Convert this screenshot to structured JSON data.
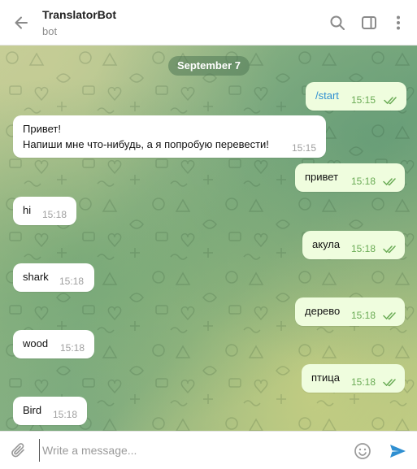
{
  "header": {
    "title": "TranslatorBot",
    "subtitle": "bot",
    "icons": [
      "back-arrow-icon",
      "search-icon",
      "sidebar-toggle-icon",
      "more-vertical-icon"
    ]
  },
  "chat": {
    "date": "September 7",
    "messages": [
      {
        "dir": "out",
        "lines": [
          "/start"
        ],
        "time": "15:15",
        "read": true,
        "command": true
      },
      {
        "dir": "in",
        "lines": [
          "Привет!",
          "Напиши мне что-нибудь, а я попробую перевести!"
        ],
        "time": "15:15"
      },
      {
        "dir": "out",
        "lines": [
          "привет"
        ],
        "time": "15:18",
        "read": true
      },
      {
        "dir": "in",
        "lines": [
          "hi"
        ],
        "time": "15:18"
      },
      {
        "dir": "out",
        "lines": [
          "акула"
        ],
        "time": "15:18",
        "read": true
      },
      {
        "dir": "in",
        "lines": [
          "shark"
        ],
        "time": "15:18"
      },
      {
        "dir": "out",
        "lines": [
          "дерево"
        ],
        "time": "15:18",
        "read": true
      },
      {
        "dir": "in",
        "lines": [
          "wood"
        ],
        "time": "15:18"
      },
      {
        "dir": "out",
        "lines": [
          "птица"
        ],
        "time": "15:18",
        "read": true
      },
      {
        "dir": "in",
        "lines": [
          "Bird"
        ],
        "time": "15:18"
      }
    ]
  },
  "composer": {
    "placeholder": "Write a message...",
    "value": ""
  },
  "colors": {
    "outgoing_bubble": "#effdde",
    "incoming_bubble": "#ffffff",
    "accent": "#2f8fd1",
    "check": "#6aab55"
  }
}
